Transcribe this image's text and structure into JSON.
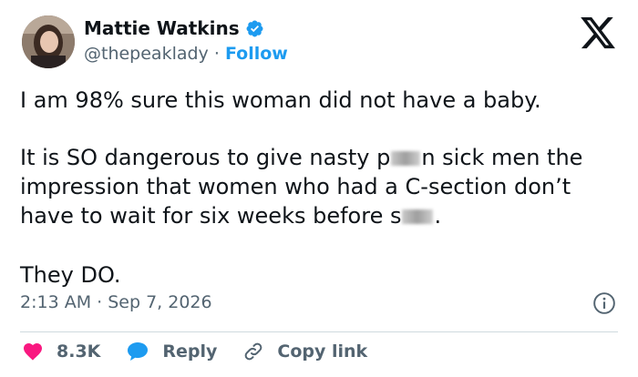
{
  "user": {
    "display_name": "Mattie Watkins",
    "handle": "@thepeaklady",
    "separator": " · ",
    "follow_label": "Follow",
    "verified": true
  },
  "tweet": {
    "paragraph1": "I am 98% sure this woman did not have a baby.",
    "paragraph2_part1": "It is SO dangerous to give nasty p",
    "paragraph2_part2": "n sick men the impression that women who had a C-section don’t have to wait for six weeks before s",
    "paragraph2_part3": ".",
    "paragraph3": "They DO.",
    "timestamp": "2:13 AM · Sep 7, 2026"
  },
  "actions": {
    "like_count": "8.3K",
    "reply_label": "Reply",
    "copy_label": "Copy link"
  },
  "colors": {
    "accent": "#1d9bf0",
    "like": "#f91880",
    "text": "#0f1419",
    "secondary": "#536471"
  },
  "icons": [
    "verified-badge-icon",
    "x-logo-icon",
    "info-icon",
    "heart-icon",
    "reply-bubble-icon",
    "link-icon"
  ]
}
